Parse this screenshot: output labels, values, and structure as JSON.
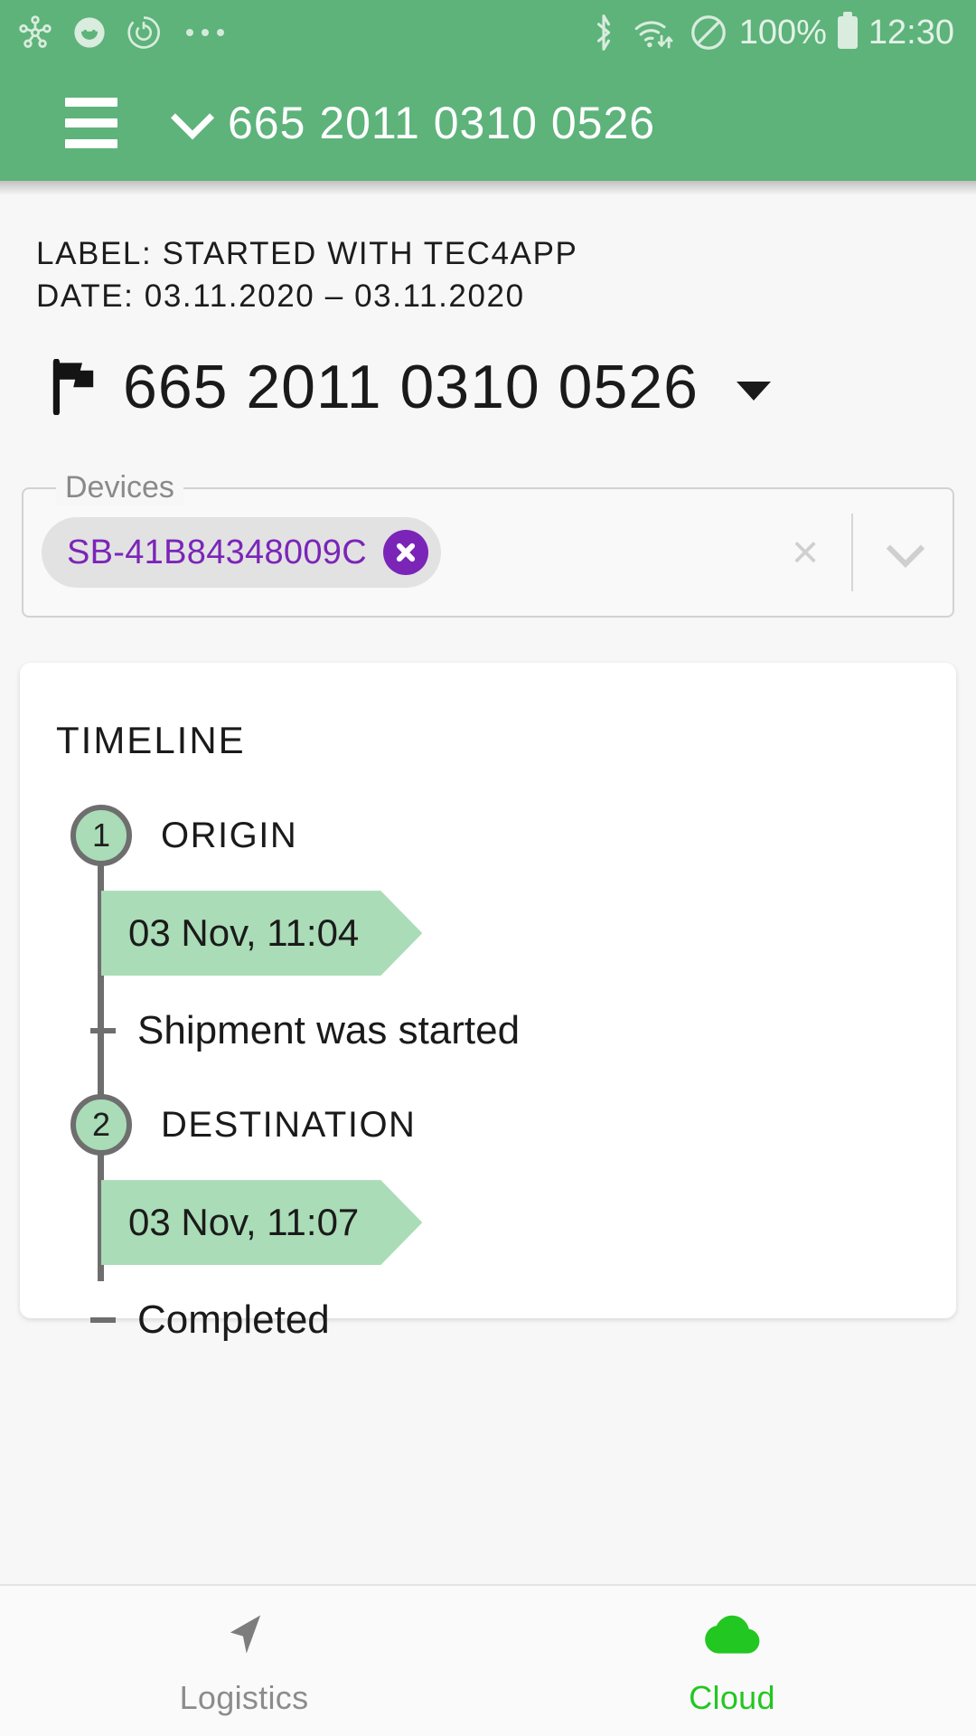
{
  "theme": {
    "header_green": "#5db37a",
    "badge_green": "#aadcb7",
    "chip_purple": "#7b25b8",
    "active_nav_green": "#22c721",
    "page_background": "#f7f7f7",
    "card_background": "#ffffff",
    "spine_gray": "#6e6e6e"
  },
  "statusbar": {
    "left_icons": [
      "molecule-icon",
      "smiley-face-icon",
      "power-ring-icon",
      "more-dots-icon"
    ],
    "bluetooth_icon": "bluetooth-icon",
    "wifi_icon": "wifi-icon",
    "dnd_icon": "do-not-disturb-icon",
    "battery_percent": "100%",
    "battery_icon": "battery-full-icon",
    "time": "12:30"
  },
  "appbar": {
    "menu_icon": "hamburger-menu-icon",
    "chevron_icon": "chevron-down-icon",
    "title": "665 2011 0310 0526"
  },
  "meta": {
    "label_line": "LABEL: STARTED WITH TEC4APP",
    "date_line": "DATE: 03.11.2020 – 03.11.2020"
  },
  "shipment": {
    "flag_icon": "flag-icon",
    "number": "665 2011 0310 0526",
    "dropdown_icon": "caret-down-icon"
  },
  "devices": {
    "legend": "Devices",
    "chips": [
      {
        "label": "SB-41B84348009C",
        "remove_icon": "chip-remove-icon"
      }
    ],
    "clear_icon": "clear-x-icon",
    "clear_glyph": "×",
    "dropdown_icon": "chevron-down-icon"
  },
  "timeline": {
    "title": "TIMELINE",
    "steps": [
      {
        "number": "1",
        "label": "ORIGIN",
        "timestamp": "03 Nov, 11:04",
        "event": "Shipment was started"
      },
      {
        "number": "2",
        "label": "DESTINATION",
        "timestamp": "03 Nov, 11:07",
        "event": "Completed"
      }
    ]
  },
  "bottomnav": {
    "items": [
      {
        "label": "Logistics",
        "icon": "navigation-arrow-icon",
        "active": false
      },
      {
        "label": "Cloud",
        "icon": "cloud-icon",
        "active": true
      }
    ]
  }
}
